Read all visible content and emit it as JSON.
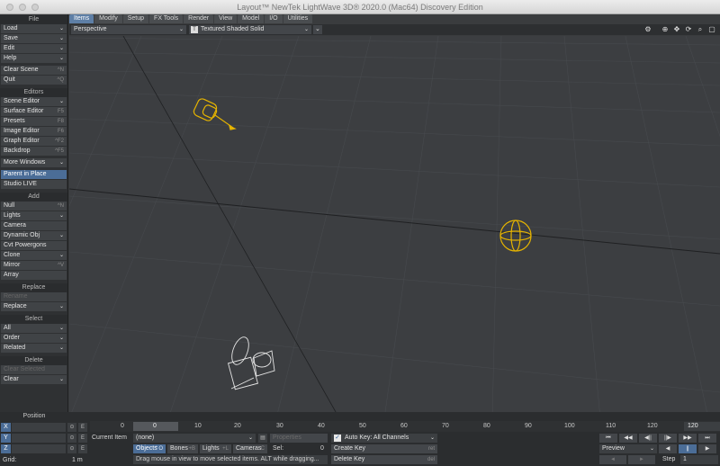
{
  "window": {
    "title": "Layout™ NewTek LightWave 3D® 2020.0 (Mac64) Discovery Edition"
  },
  "left_panel": {
    "file": {
      "header": "File",
      "items": [
        {
          "label": "Load",
          "dropdown": "⌄"
        },
        {
          "label": "Save",
          "dropdown": "⌄"
        },
        {
          "label": "Edit",
          "dropdown": "⌄"
        },
        {
          "label": "Help",
          "dropdown": "⌄"
        }
      ]
    },
    "file_extra": [
      {
        "label": "Clear Scene",
        "shortcut": "^N"
      },
      {
        "label": "Quit",
        "shortcut": "^Q"
      }
    ],
    "editors": {
      "header": "Editors",
      "items": [
        {
          "label": "Scene Editor",
          "dropdown": "⌄"
        },
        {
          "label": "Surface Editor",
          "shortcut": "F5"
        },
        {
          "label": "Presets",
          "shortcut": "F8"
        },
        {
          "label": "Image Editor",
          "shortcut": "F6"
        },
        {
          "label": "Graph Editor",
          "shortcut": "^F2"
        },
        {
          "label": "Backdrop",
          "shortcut": "^F5"
        }
      ]
    },
    "more_windows": {
      "label": "More Windows",
      "dropdown": "⌄"
    },
    "parent_in_place": "Parent in Place",
    "studio_live": "Studio LIVE",
    "add": {
      "header": "Add",
      "items": [
        {
          "label": "Null",
          "shortcut": "^N"
        },
        {
          "label": "Lights",
          "dropdown": "⌄"
        },
        {
          "label": "Camera",
          "shortcut": ""
        },
        {
          "label": "Dynamic Obj",
          "dropdown": "⌄"
        },
        {
          "label": "Cvt Powergons",
          "shortcut": ""
        },
        {
          "label": "Clone",
          "dropdown": "⌄"
        },
        {
          "label": "Mirror",
          "shortcut": "^V"
        },
        {
          "label": "Array",
          "shortcut": ""
        }
      ]
    },
    "replace": {
      "header": "Replace",
      "items": [
        {
          "label": "Rename",
          "disabled": true
        },
        {
          "label": "Replace",
          "dropdown": "⌄"
        }
      ]
    },
    "select": {
      "header": "Select",
      "items": [
        {
          "label": "All",
          "dropdown": "⌄"
        },
        {
          "label": "Order",
          "dropdown": "⌄"
        },
        {
          "label": "Related",
          "dropdown": "⌄"
        }
      ]
    },
    "delete": {
      "header": "Delete",
      "items": [
        {
          "label": "Clear Selected",
          "disabled": true
        },
        {
          "label": "Clear",
          "dropdown": "⌄"
        }
      ]
    }
  },
  "tabs": [
    "Items",
    "Modify",
    "Setup",
    "FX Tools",
    "Render",
    "View",
    "Model",
    "I/O",
    "Utilities"
  ],
  "viewport_header": {
    "view_mode": "Perspective",
    "shading_mode": "Textured Shaded Solid",
    "dropdown": "⌄",
    "icons": [
      "⚙",
      "⊕",
      "✥",
      "⟳",
      "⌕",
      "▢"
    ]
  },
  "position": {
    "header": "Position",
    "x_label": "X",
    "y_label": "Y",
    "z_label": "Z",
    "lock_icon": "⊙",
    "env_icon": "E",
    "grid_label": "Grid:",
    "grid_value": "1 m"
  },
  "timeline": {
    "start": "0",
    "current": "0",
    "ticks": [
      "10",
      "20",
      "30",
      "40",
      "50",
      "60",
      "70",
      "80",
      "90",
      "100",
      "110",
      "120"
    ],
    "end": "120"
  },
  "bottom": {
    "current_item_label": "Current Item",
    "current_item_value": "(none)",
    "properties_label": "Properties",
    "objects_label": "Objects",
    "objects_shortcut": "⌃O",
    "bones_label": "Bones",
    "bones_shortcut": "+B",
    "lights_label": "Lights",
    "lights_shortcut": "+L",
    "cameras_label": "Cameras",
    "cameras_shortcut": "C",
    "sel_label": "Sel:",
    "sel_value": "0",
    "auto_key_label": "Auto Key: All Channels",
    "create_key_label": "Create Key",
    "create_key_shortcut": "ret",
    "delete_key_label": "Delete Key",
    "delete_key_shortcut": "del",
    "status_text": "Drag mouse in view to move selected items. ALT while dragging...",
    "preview_label": "Preview",
    "step_label": "Step",
    "step_value": "1",
    "transport_row1": [
      "⏮",
      "◀◀",
      "◀||",
      "||▶",
      "▶▶",
      "⏭"
    ],
    "transport_row2": [
      "◀",
      "||",
      "▶"
    ],
    "transport_row3": [
      "◄",
      "►"
    ]
  },
  "colors": {
    "accent": "#4b6d97",
    "viewport_bg": "#3c3e41",
    "selected_item": "#e6b400"
  }
}
